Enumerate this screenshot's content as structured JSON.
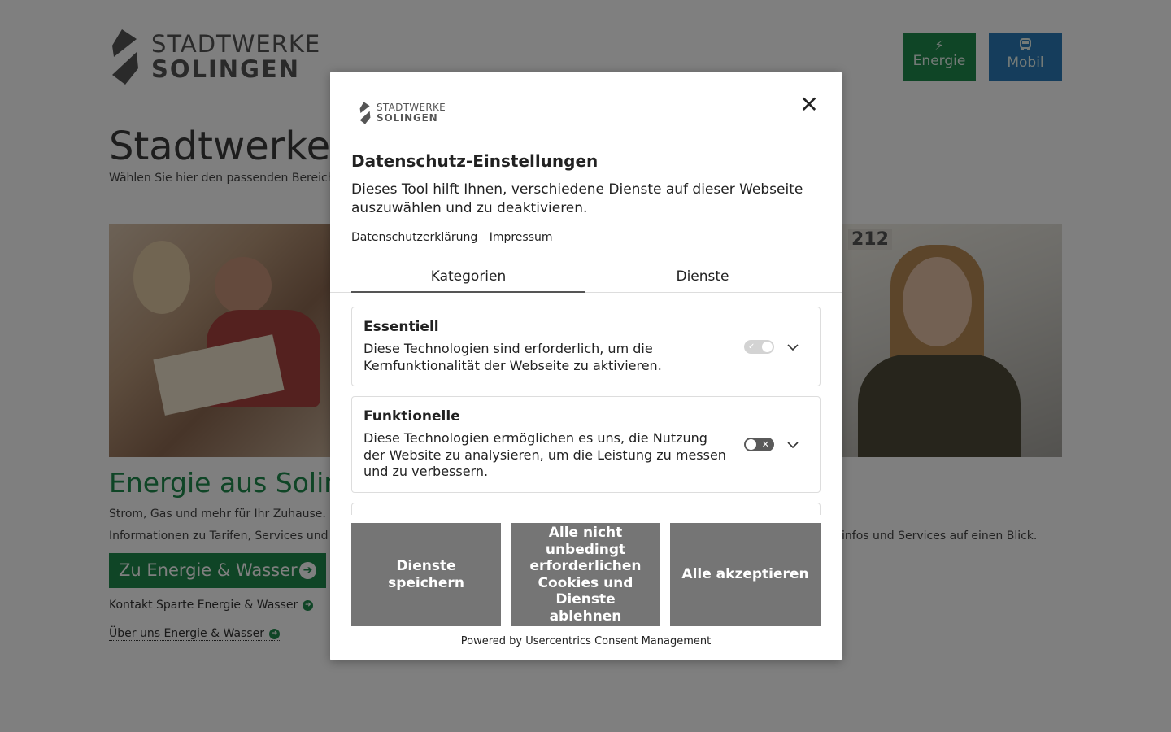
{
  "background": {
    "logo": {
      "line1": "STADTWERKE",
      "line2": "SOLINGEN"
    },
    "nav": [
      {
        "label": "Energie",
        "icon": "lightning-icon",
        "color": "#1f8a4c"
      },
      {
        "label": "Mobil",
        "icon": "bus-icon",
        "color": "#2a7ab9"
      }
    ],
    "hero_title": "Stadtwerke Solingen",
    "hero_sub": "Wählen Sie hier den passenden Bereich für Ihr Anliegen.",
    "image_right_label": "212",
    "energy": {
      "title": "Energie aus Solingen",
      "line1": "Strom, Gas und mehr für Ihr Zuhause.",
      "line2": "Informationen zu Tarifen, Services und Angeboten.",
      "cta": "Zu Energie & Wasser",
      "links": [
        "Kontakt Sparte Energie & Wasser",
        "Über uns Energie & Wasser"
      ]
    },
    "mobil_line2": "infos und Services auf einen Blick."
  },
  "modal": {
    "logo": {
      "line1": "STADTWERKE",
      "line2": "SOLINGEN"
    },
    "close_icon": "close-icon",
    "title": "Datenschutz-Einstellungen",
    "description": "Dieses Tool hilft Ihnen, verschiedene Dienste auf dieser Webseite auszuwählen und zu deaktivieren.",
    "links": [
      "Datenschutzerklärung",
      "Impressum"
    ],
    "tabs": [
      {
        "label": "Kategorien",
        "active": true
      },
      {
        "label": "Dienste",
        "active": false
      }
    ],
    "categories": [
      {
        "title": "Essentiell",
        "description": "Diese Technologien sind erforderlich, um die Kernfunktionalität der Webseite zu aktivieren.",
        "enabled": true,
        "locked": true
      },
      {
        "title": "Funktionelle",
        "description": "Diese Technologien ermöglichen es uns, die Nutzung der Website zu analysieren, um die Leistung zu messen und zu verbessern.",
        "enabled": false,
        "locked": false
      }
    ],
    "buttons": {
      "save": "Dienste speichern",
      "deny": "Alle nicht unbedingt erforderlichen Cookies und Dienste ablehnen",
      "accept": "Alle akzeptieren"
    },
    "powered_by": "Powered by Usercentrics Consent Management"
  },
  "colors": {
    "green": "#1f8a4c",
    "blue": "#2a7ab9",
    "button_gray": "#757575"
  }
}
